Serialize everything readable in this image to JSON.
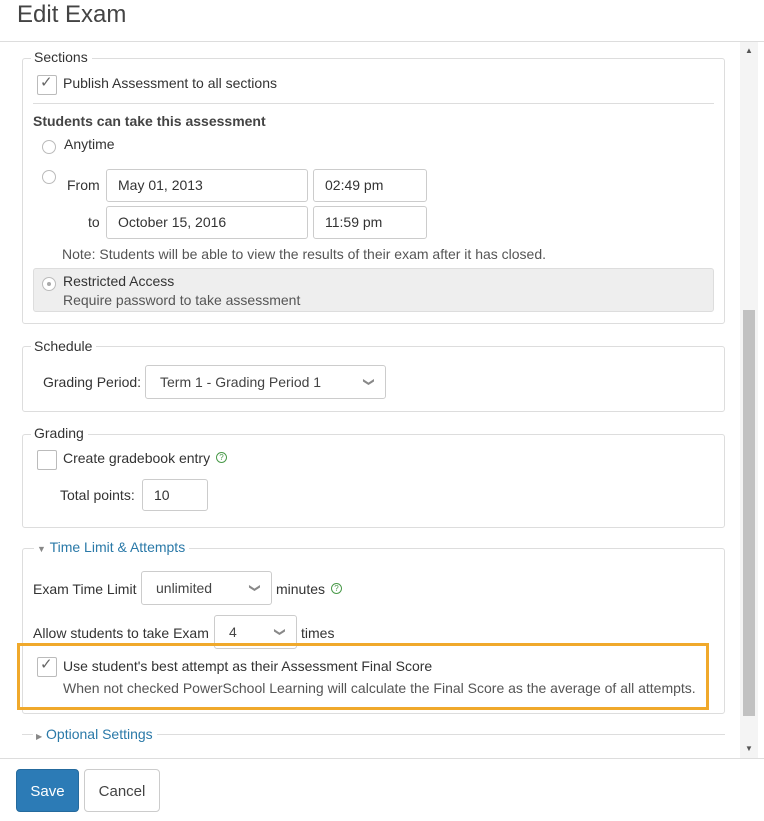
{
  "header": {
    "title": "Edit Exam"
  },
  "sections": {
    "legend": "Sections",
    "publish_label": "Publish Assessment to all sections",
    "availability_title": "Students can take this assessment",
    "anytime_label": "Anytime",
    "from_label": "From",
    "to_label": "to",
    "from_date": "May 01, 2013",
    "from_time": "02:49 pm",
    "to_date": "October 15, 2016",
    "to_time": "11:59 pm",
    "note": "Note: Students will be able to view the results of their exam after it has closed.",
    "restricted_title": "Restricted Access",
    "restricted_desc": "Require password to take assessment"
  },
  "schedule": {
    "legend": "Schedule",
    "grading_period_label": "Grading Period:",
    "grading_period_value": "Term 1 - Grading Period 1"
  },
  "grading": {
    "legend": "Grading",
    "gradebook_label": "Create gradebook entry",
    "total_points_label": "Total points:",
    "total_points_value": "10"
  },
  "time_limit": {
    "legend": "Time Limit & Attempts",
    "exam_time_label": "Exam Time Limit",
    "exam_time_value": "unlimited",
    "minutes_label": "minutes",
    "attempts_label": "Allow students to take Exam",
    "attempts_value": "4",
    "times_label": "times",
    "best_attempt_label": "Use student's best attempt as their Assessment Final Score",
    "best_attempt_desc": "When not checked PowerSchool Learning will calculate the Final Score as the average of all attempts."
  },
  "optional": {
    "legend": "Optional Settings"
  },
  "footer": {
    "save_label": "Save",
    "cancel_label": "Cancel"
  },
  "colors": {
    "accent": "#2a79a8",
    "highlight": "#f0a92b",
    "save": "#2c7bb6"
  },
  "icons": {
    "help": "?",
    "chevron": "❯",
    "expanded": "▼",
    "collapsed": "▶",
    "scroll_up": "▲",
    "scroll_down": "▼"
  }
}
